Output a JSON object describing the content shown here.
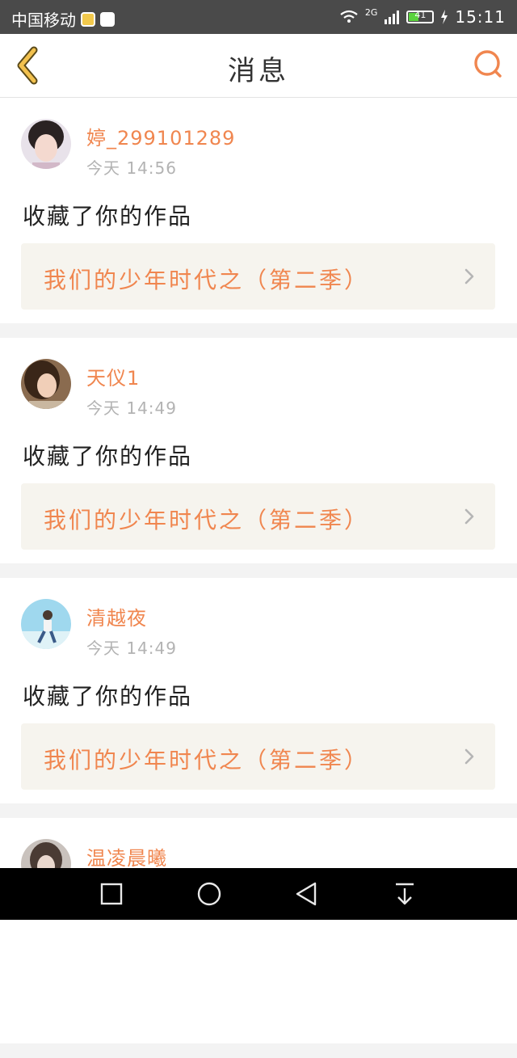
{
  "status_bar": {
    "carrier": "中国移动",
    "network": "2G",
    "battery": "41",
    "time": "15:11"
  },
  "header": {
    "title": "消息"
  },
  "messages": [
    {
      "username": "婷_299101289",
      "time": "今天 14:56",
      "action": "收藏了你的作品",
      "work_title": "我们的少年时代之（第二季）"
    },
    {
      "username": "天仪1",
      "time": "今天 14:49",
      "action": "收藏了你的作品",
      "work_title": "我们的少年时代之（第二季）"
    },
    {
      "username": "清越夜",
      "time": "今天 14:49",
      "action": "收藏了你的作品",
      "work_title": "我们的少年时代之（第二季）"
    },
    {
      "username": "温凌晨曦"
    }
  ],
  "colors": {
    "accent": "#f0864f",
    "card_highlight": "#f6f4ee",
    "status_bar": "#4a4a4a"
  },
  "icons": {
    "back": "chevron-left-icon",
    "search": "search-icon",
    "row_arrow": "chevron-right-icon"
  }
}
